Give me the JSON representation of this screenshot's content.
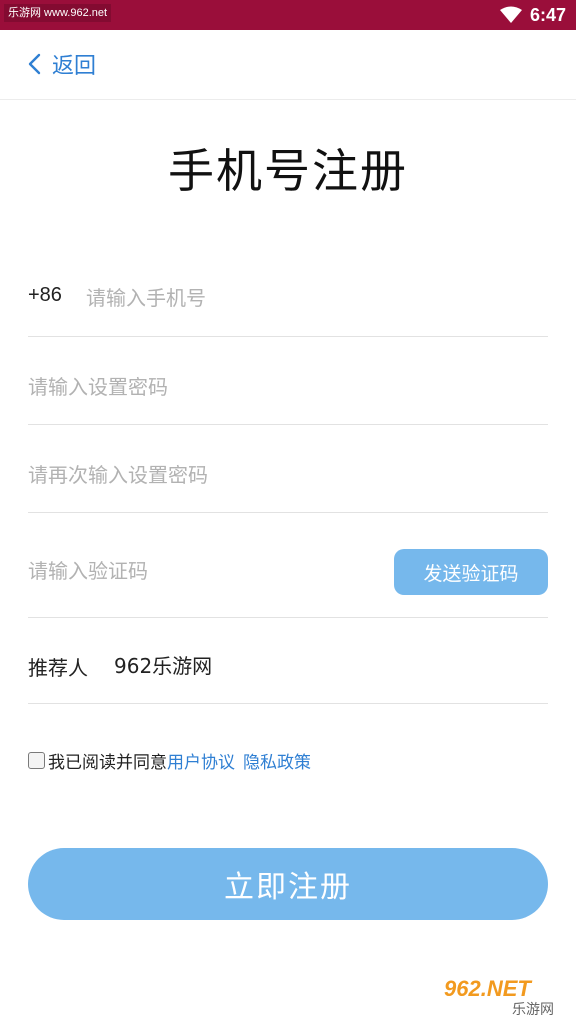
{
  "status_bar": {
    "watermark": "乐游网 www.962.net",
    "time": "6:47",
    "bg_color": "#9a0e3a"
  },
  "header": {
    "back_label": "返回",
    "back_icon": "chevron-left-icon"
  },
  "page_title": "手机号注册",
  "form": {
    "phone_prefix": "+86",
    "phone_placeholder": "请输入手机号",
    "password_placeholder": "请输入设置密码",
    "confirm_password_placeholder": "请再次输入设置密码",
    "code_placeholder": "请输入验证码",
    "send_code_label": "发送验证码",
    "referrer_label": "推荐人",
    "referrer_value": "962乐游网"
  },
  "agreement": {
    "text": "我已阅读并同意",
    "user_agreement": "用户协议",
    "privacy_policy": "隐私政策",
    "checked": false
  },
  "register_label": "立即注册",
  "watermark_logo": {
    "text": "962.NET",
    "subtext": "乐游网"
  },
  "colors": {
    "accent": "#2f7fd3",
    "button": "#76b8ec",
    "status_bar": "#9a0e3a"
  }
}
